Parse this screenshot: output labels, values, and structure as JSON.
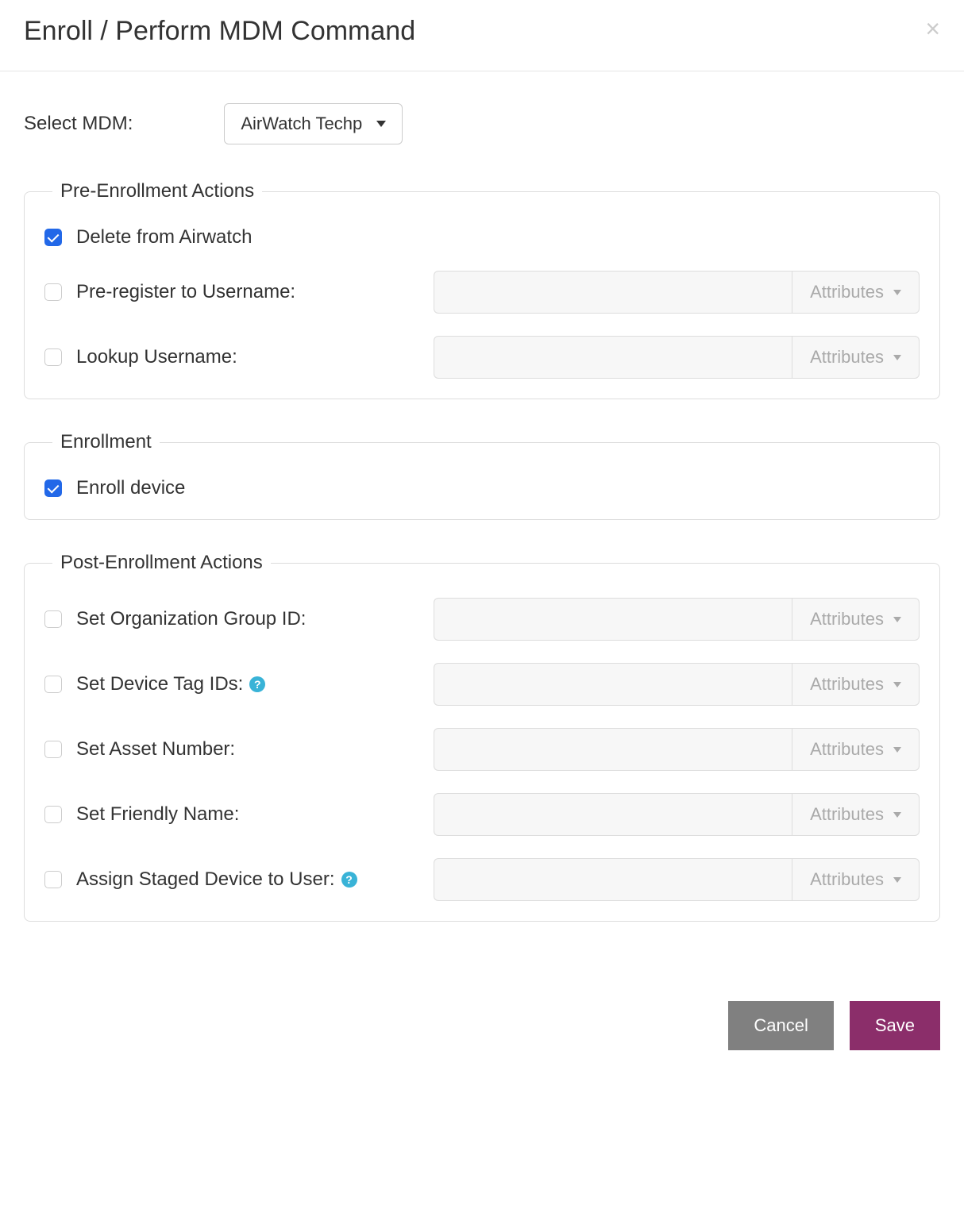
{
  "header": {
    "title": "Enroll / Perform MDM Command"
  },
  "mdm_select": {
    "label": "Select MDM:",
    "value": "AirWatch Techp"
  },
  "attributes_label": "Attributes",
  "fieldsets": {
    "pre_enrollment": {
      "legend": "Pre-Enrollment Actions",
      "items": [
        {
          "label": "Delete from Airwatch",
          "checked": true,
          "has_input": false,
          "has_help": false
        },
        {
          "label": "Pre-register to Username:",
          "checked": false,
          "has_input": true,
          "has_help": false
        },
        {
          "label": "Lookup Username:",
          "checked": false,
          "has_input": true,
          "has_help": false
        }
      ]
    },
    "enrollment": {
      "legend": "Enrollment",
      "items": [
        {
          "label": "Enroll device",
          "checked": true,
          "has_input": false,
          "has_help": false
        }
      ]
    },
    "post_enrollment": {
      "legend": "Post-Enrollment Actions",
      "items": [
        {
          "label": "Set Organization Group ID:",
          "checked": false,
          "has_input": true,
          "has_help": false
        },
        {
          "label": "Set Device Tag IDs:",
          "checked": false,
          "has_input": true,
          "has_help": true
        },
        {
          "label": "Set Asset Number:",
          "checked": false,
          "has_input": true,
          "has_help": false
        },
        {
          "label": "Set Friendly Name:",
          "checked": false,
          "has_input": true,
          "has_help": false
        },
        {
          "label": "Assign Staged Device to User:",
          "checked": false,
          "has_input": true,
          "has_help": true
        }
      ]
    }
  },
  "footer": {
    "cancel": "Cancel",
    "save": "Save"
  }
}
